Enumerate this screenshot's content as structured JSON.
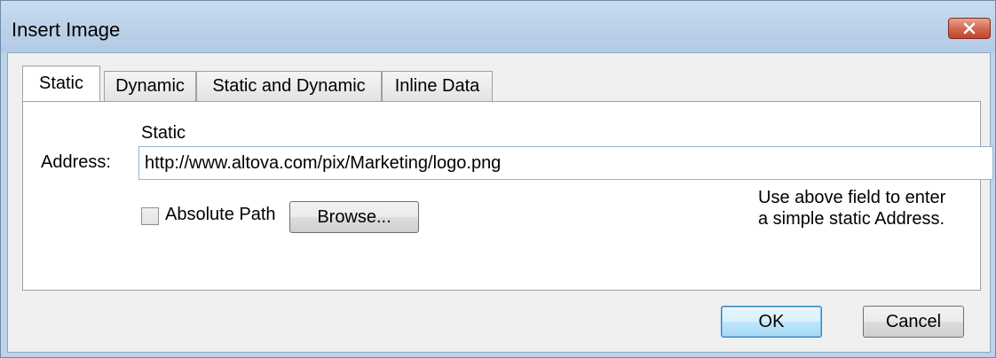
{
  "window": {
    "title": "Insert Image",
    "close_icon": "close-icon",
    "accent": "#c3442c"
  },
  "tabs": [
    {
      "label": "Static",
      "active": true
    },
    {
      "label": "Dynamic",
      "active": false
    },
    {
      "label": "Static and Dynamic",
      "active": false
    },
    {
      "label": "Inline Data",
      "active": false
    }
  ],
  "static_panel": {
    "section_label": "Static",
    "address_label": "Address:",
    "address_value": "http://www.altova.com/pix/Marketing/logo.png",
    "absolute_path_label": "Absolute Path",
    "absolute_path_checked": false,
    "browse_label": "Browse...",
    "hint_line1": "Use above field to enter",
    "hint_line2": "a simple static Address."
  },
  "footer": {
    "ok_label": "OK",
    "cancel_label": "Cancel"
  }
}
